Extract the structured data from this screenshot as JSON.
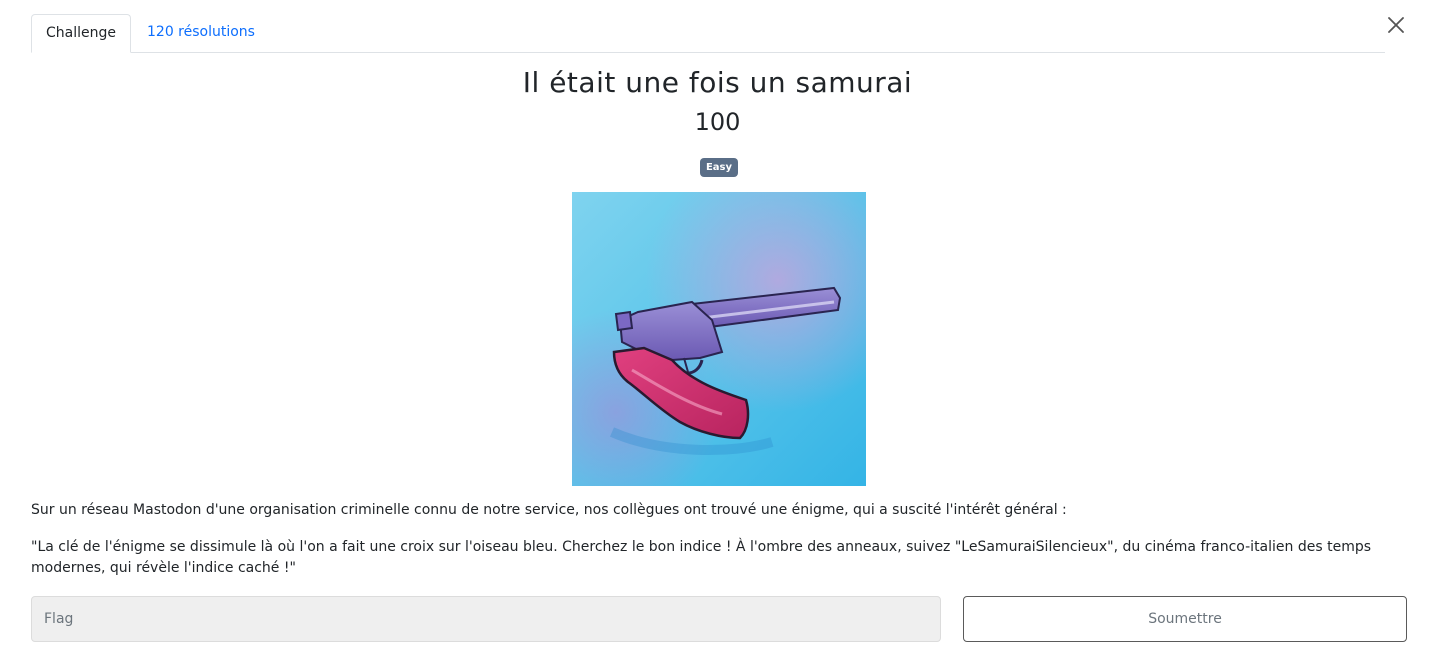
{
  "tabs": [
    {
      "label": "Challenge",
      "active": true
    },
    {
      "label": "120 résolutions",
      "active": false
    }
  ],
  "close_icon": "close-icon",
  "challenge": {
    "title": "Il était une fois un samurai",
    "points": "100",
    "difficulty": "Easy",
    "image_alt": "revolver-watercolor-illustration",
    "description_1": "Sur un réseau Mastodon d'une organisation criminelle connu de notre service, nos collègues ont trouvé une énigme, qui a suscité l'intérêt général :",
    "description_2": "\"La clé de l'énigme se dissimule là où l'on a fait une croix sur l'oiseau bleu. Cherchez le bon indice ! À l'ombre des anneaux, suivez \"LeSamuraiSilencieux\", du cinéma franco-italien des temps modernes, qui révèle l'indice caché !\""
  },
  "form": {
    "flag_placeholder": "Flag",
    "flag_value": "",
    "submit_label": "Soumettre"
  },
  "colors": {
    "link": "#0d6efd",
    "badge": "#5a6e87",
    "input_bg": "#efefef"
  }
}
